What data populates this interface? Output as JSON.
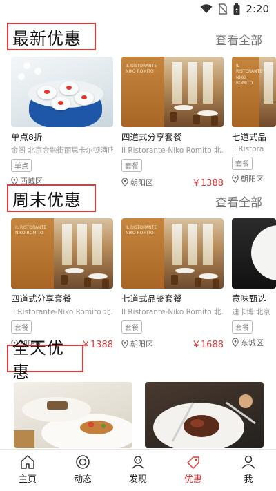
{
  "status_bar": {
    "time": "2:20"
  },
  "sections": {
    "latest": {
      "title": "最新优惠",
      "see_all": "查看全部"
    },
    "weekend": {
      "title": "周末优惠",
      "see_all": "查看全部"
    },
    "allday": {
      "title": "全天优惠"
    }
  },
  "latest_cards": [
    {
      "title": "单点8折",
      "subtitle": "金阁 北京金融街丽思卡尔顿酒店",
      "tag": "单点",
      "location": "西城区",
      "price": ""
    },
    {
      "title": "四道式分享套餐",
      "subtitle": "Il Ristorante-Niko Romito 北...",
      "tag": "套餐",
      "location": "朝阳区",
      "price": "￥1388"
    },
    {
      "title": "七道式品",
      "subtitle": "Il Ristora",
      "tag": "套餐",
      "location": "朝阳区",
      "price": ""
    }
  ],
  "weekend_cards": [
    {
      "title": "四道式分享套餐",
      "subtitle": "Il Ristorante-Niko Romito 北...",
      "tag": "套餐",
      "location": "朝阳区",
      "price": "￥1388"
    },
    {
      "title": "七道式品鉴套餐",
      "subtitle": "Il Ristorante-Niko Romito 北...",
      "tag": "套餐",
      "location": "朝阳区",
      "price": "￥1688"
    },
    {
      "title": "意味甄选",
      "subtitle": "迪卡博 北京",
      "tag": "套餐",
      "location": "东城区",
      "price": ""
    }
  ],
  "menu_card_text": "IL RISTORANTE\nNIKO ROMITO",
  "tabs": [
    {
      "label": "主页",
      "icon": "home-icon"
    },
    {
      "label": "动态",
      "icon": "moments-icon"
    },
    {
      "label": "发现",
      "icon": "discover-icon"
    },
    {
      "label": "优惠",
      "icon": "coupon-icon"
    },
    {
      "label": "我",
      "icon": "profile-icon"
    }
  ],
  "colors": {
    "accent": "#e03a3a",
    "text": "#222222",
    "muted": "#999999"
  }
}
